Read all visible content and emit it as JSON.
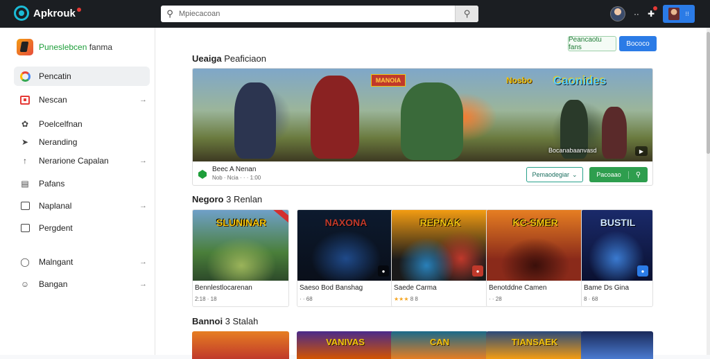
{
  "topbar": {
    "logo_text": "Apkrouk",
    "search_placeholder": "Mpiecacoan",
    "icons": [
      "search-icon",
      "avatar",
      "more-icon",
      "notification-icon",
      "profile-menu"
    ],
    "dots": "··",
    "menu": "⁝⁝"
  },
  "sidebar": {
    "brand_prefix": "Puneslebcen",
    "brand_suffix": " fanma",
    "items": [
      {
        "label": "Pencatin",
        "icon": "google-icon",
        "arrow": false,
        "active": true
      },
      {
        "label": "Nescan",
        "icon": "calendar-icon",
        "arrow": true,
        "active": false
      },
      {
        "label": "Poelcelfnan",
        "icon": "tag-icon",
        "arrow": false,
        "active": false
      },
      {
        "label": "Neranding",
        "icon": "compass-icon",
        "arrow": false,
        "active": false
      },
      {
        "label": "Nerarione Capalan",
        "icon": "upload-icon",
        "arrow": true,
        "active": false
      },
      {
        "label": "Pafans",
        "icon": "document-icon",
        "arrow": false,
        "active": false
      },
      {
        "label": "Naplanal",
        "icon": "folder-icon",
        "arrow": true,
        "active": false
      },
      {
        "label": "Pergdent",
        "icon": "square-icon",
        "arrow": false,
        "active": false
      },
      {
        "label": "Malngant",
        "icon": "shield-icon",
        "arrow": true,
        "active": false
      },
      {
        "label": "Bangan",
        "icon": "smiley-icon",
        "arrow": true,
        "active": false
      }
    ]
  },
  "main": {
    "btn_outline": "Peancaotu fans",
    "btn_blue": "Bococo",
    "featured_title_bold": "Ueaiga",
    "featured_title_rest": " Peaficiaon",
    "hero": {
      "tag": "MANOIA",
      "logo_a": "Nosbo",
      "logo_b": "Caonides",
      "caption": "Bocanabaanvasd",
      "title": "Beec A Nenan",
      "meta": "Nob  ·  Ncia  ·  ·  ·  1:00",
      "select_label": "Pemaodegiar",
      "install_label": "Pacoaao"
    },
    "section2_bold": "Negoro",
    "section2_rest": " 3 Renlan",
    "cards": [
      {
        "art_title": "SLUNINAR",
        "title": "Bennlestlocarenan",
        "meta": "2:18  ·  18",
        "stars": "",
        "colors": [
          "#4a7f3a",
          "#9bb45a",
          "#2d4a2a"
        ]
      },
      {
        "art_title": "NAXONA",
        "title": "Saeso Bod Banshag",
        "meta": "·  ·  68",
        "stars": "",
        "colors": [
          "#0c1a2e",
          "#1f4a8a",
          "#0a0f1a"
        ]
      },
      {
        "art_title": "REPNAK",
        "title": "Saede Carma",
        "meta": "  8 8",
        "stars": "★★★",
        "colors": [
          "#1a1a1a",
          "#c0392b",
          "#f39c12"
        ]
      },
      {
        "art_title": "KC-SMER",
        "title": "Benotddne Camen",
        "meta": "·  ·  28",
        "stars": "",
        "colors": [
          "#8a2a1a",
          "#e67e22",
          "#3a0f0a"
        ]
      },
      {
        "art_title": "BUSTIL",
        "title": "Bame Ds Gina",
        "meta": "8  ·  68",
        "stars": "",
        "colors": [
          "#1a2a6a",
          "#3a7ad0",
          "#0a1030"
        ]
      }
    ],
    "section3_bold": "Bannoi",
    "section3_rest": " 3 Stalah",
    "cards2": [
      {
        "art_title": "",
        "colors": [
          "#c0392b",
          "#e67e22"
        ]
      },
      {
        "art_title": "VANIVAS",
        "colors": [
          "#4a2a8a",
          "#d35400"
        ]
      },
      {
        "art_title": "CAN",
        "colors": [
          "#1a6a8a",
          "#e67e22"
        ]
      },
      {
        "art_title": "TIANSAEK",
        "colors": [
          "#2a4a7a",
          "#f39c12"
        ]
      },
      {
        "art_title": "",
        "colors": [
          "#1a2a5a",
          "#4a7ad0"
        ]
      }
    ]
  }
}
